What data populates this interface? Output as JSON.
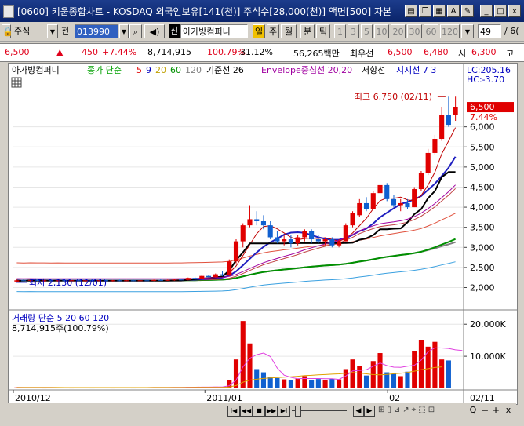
{
  "window": {
    "title": "[0600] 키움종합차트 - KOSDAQ 외국인보유[141(천)] 주식수[28,000(천)] 액면[500] 자본",
    "buttons": [
      "_",
      "□",
      "x"
    ]
  },
  "toolbar": {
    "market_label": "주식",
    "jeon_label": "전",
    "code": "013990",
    "company_chip": "신",
    "company_name": "아가방컴퍼니",
    "period_tabs": [
      "일",
      "주",
      "월",
      "분",
      "틱"
    ],
    "minute_numbers": [
      "1",
      "3",
      "5",
      "10",
      "20",
      "30",
      "60",
      "120"
    ],
    "count_value": "49",
    "right_edge": "/ 6("
  },
  "info": {
    "price": "6,500",
    "arrow": "▲",
    "change": "450",
    "change_pct": "+7.44%",
    "volume": "8,714,915",
    "vol_ratio": "100.79%",
    "turnover": "31.12%",
    "amount": "56,265백만",
    "best_label": "최우선",
    "ask": "6,500",
    "bid": "6,480",
    "open_label": "시",
    "open": "6,300",
    "high_label": "고"
  },
  "chart_data": {
    "type": "candlestick",
    "legend": {
      "name": "아가방컴퍼니",
      "ma_label": "종가 단순",
      "ma_periods": [
        "5",
        "9",
        "20",
        "60",
        "120"
      ],
      "kijun": "기준선 26",
      "envelope": "Envelope중심선 20,20",
      "resistance": "저항선",
      "support": "지지선 7 3"
    },
    "top_right": {
      "lc": "LC:205.16",
      "hc": "HC:-3.70"
    },
    "current_price_label": "6,500",
    "current_pct_label": "7.44%",
    "max_annotation": "최고 6,750 (02/11)",
    "min_annotation": "최저 2,130 (12/01)",
    "y_price_ticks": [
      6000,
      5500,
      5000,
      4500,
      4000,
      3500,
      3000,
      2500,
      2000
    ],
    "y_price_labels": [
      "6,000",
      "5,500",
      "5,000",
      "4,500",
      "4,000",
      "3,500",
      "3,000",
      "2,500",
      "2,000"
    ],
    "ylim": [
      1600,
      6950
    ],
    "candles": [
      {
        "o": 2150,
        "h": 2200,
        "l": 2130,
        "c": 2180
      },
      {
        "o": 2180,
        "h": 2210,
        "l": 2160,
        "c": 2170
      },
      {
        "o": 2170,
        "h": 2200,
        "l": 2150,
        "c": 2190
      },
      {
        "o": 2190,
        "h": 2200,
        "l": 2160,
        "c": 2170
      },
      {
        "o": 2170,
        "h": 2190,
        "l": 2150,
        "c": 2180
      },
      {
        "o": 2180,
        "h": 2200,
        "l": 2160,
        "c": 2170
      },
      {
        "o": 2170,
        "h": 2190,
        "l": 2150,
        "c": 2180
      },
      {
        "o": 2180,
        "h": 2200,
        "l": 2160,
        "c": 2170
      },
      {
        "o": 2170,
        "h": 2190,
        "l": 2160,
        "c": 2180
      },
      {
        "o": 2180,
        "h": 2200,
        "l": 2160,
        "c": 2170
      },
      {
        "o": 2170,
        "h": 2190,
        "l": 2150,
        "c": 2180
      },
      {
        "o": 2180,
        "h": 2200,
        "l": 2160,
        "c": 2170
      },
      {
        "o": 2170,
        "h": 2190,
        "l": 2160,
        "c": 2180
      },
      {
        "o": 2180,
        "h": 2200,
        "l": 2160,
        "c": 2170
      },
      {
        "o": 2170,
        "h": 2190,
        "l": 2150,
        "c": 2180
      },
      {
        "o": 2180,
        "h": 2200,
        "l": 2160,
        "c": 2170
      },
      {
        "o": 2170,
        "h": 2190,
        "l": 2160,
        "c": 2180
      },
      {
        "o": 2180,
        "h": 2200,
        "l": 2160,
        "c": 2170
      },
      {
        "o": 2170,
        "h": 2190,
        "l": 2160,
        "c": 2180
      },
      {
        "o": 2180,
        "h": 2200,
        "l": 2160,
        "c": 2170
      },
      {
        "o": 2170,
        "h": 2200,
        "l": 2160,
        "c": 2190
      },
      {
        "o": 2190,
        "h": 2210,
        "l": 2170,
        "c": 2180
      },
      {
        "o": 2180,
        "h": 2200,
        "l": 2170,
        "c": 2190
      },
      {
        "o": 2190,
        "h": 2220,
        "l": 2170,
        "c": 2200
      },
      {
        "o": 2200,
        "h": 2220,
        "l": 2180,
        "c": 2190
      },
      {
        "o": 2190,
        "h": 2250,
        "l": 2180,
        "c": 2240
      },
      {
        "o": 2240,
        "h": 2270,
        "l": 2200,
        "c": 2220
      },
      {
        "o": 2220,
        "h": 2300,
        "l": 2210,
        "c": 2290
      },
      {
        "o": 2290,
        "h": 2320,
        "l": 2250,
        "c": 2260
      },
      {
        "o": 2260,
        "h": 2350,
        "l": 2250,
        "c": 2330
      },
      {
        "o": 2330,
        "h": 2400,
        "l": 2280,
        "c": 2300
      },
      {
        "o": 2300,
        "h": 2700,
        "l": 2290,
        "c": 2650
      },
      {
        "o": 2650,
        "h": 3200,
        "l": 2600,
        "c": 3150
      },
      {
        "o": 3150,
        "h": 3600,
        "l": 3000,
        "c": 3550
      },
      {
        "o": 3550,
        "h": 4050,
        "l": 3500,
        "c": 3700
      },
      {
        "o": 3700,
        "h": 3900,
        "l": 3550,
        "c": 3650
      },
      {
        "o": 3650,
        "h": 3800,
        "l": 3450,
        "c": 3550
      },
      {
        "o": 3550,
        "h": 3650,
        "l": 3200,
        "c": 3250
      },
      {
        "o": 3250,
        "h": 3400,
        "l": 3100,
        "c": 3150
      },
      {
        "o": 3150,
        "h": 3300,
        "l": 3050,
        "c": 3200
      },
      {
        "o": 3200,
        "h": 3300,
        "l": 3000,
        "c": 3100
      },
      {
        "o": 3100,
        "h": 3300,
        "l": 3050,
        "c": 3250
      },
      {
        "o": 3250,
        "h": 3450,
        "l": 3150,
        "c": 3400
      },
      {
        "o": 3400,
        "h": 3450,
        "l": 3100,
        "c": 3200
      },
      {
        "o": 3200,
        "h": 3300,
        "l": 3100,
        "c": 3150
      },
      {
        "o": 3150,
        "h": 3250,
        "l": 3050,
        "c": 3200
      },
      {
        "o": 3200,
        "h": 3250,
        "l": 3000,
        "c": 3050
      },
      {
        "o": 3050,
        "h": 3200,
        "l": 3000,
        "c": 3150
      },
      {
        "o": 3150,
        "h": 3600,
        "l": 3150,
        "c": 3550
      },
      {
        "o": 3550,
        "h": 3900,
        "l": 3500,
        "c": 3850
      },
      {
        "o": 3800,
        "h": 4200,
        "l": 3750,
        "c": 4100
      },
      {
        "o": 4100,
        "h": 4250,
        "l": 3900,
        "c": 3950
      },
      {
        "o": 3950,
        "h": 4400,
        "l": 3950,
        "c": 4350
      },
      {
        "o": 4350,
        "h": 4650,
        "l": 4300,
        "c": 4550
      },
      {
        "o": 4550,
        "h": 4600,
        "l": 4150,
        "c": 4200
      },
      {
        "o": 4200,
        "h": 4300,
        "l": 4000,
        "c": 4050
      },
      {
        "o": 4050,
        "h": 4200,
        "l": 3900,
        "c": 4100
      },
      {
        "o": 4100,
        "h": 4200,
        "l": 3950,
        "c": 4000
      },
      {
        "o": 4000,
        "h": 4500,
        "l": 4000,
        "c": 4450
      },
      {
        "o": 4450,
        "h": 4900,
        "l": 4400,
        "c": 4850
      },
      {
        "o": 4850,
        "h": 5450,
        "l": 4800,
        "c": 5350
      },
      {
        "o": 5350,
        "h": 5800,
        "l": 5300,
        "c": 5700
      },
      {
        "o": 5700,
        "h": 6500,
        "l": 5650,
        "c": 6300
      },
      {
        "o": 6300,
        "h": 6750,
        "l": 6000,
        "c": 6050
      },
      {
        "o": 6300,
        "h": 6750,
        "l": 6150,
        "c": 6500
      }
    ],
    "volume": {
      "label": "거래량 단순 5 20 60 120",
      "current": "8,714,915주(100.79%)",
      "y_ticks": [
        20000,
        10000
      ],
      "y_labels": [
        "20,000K",
        "10,000K"
      ],
      "ylim": [
        0,
        22500
      ],
      "values": [
        300,
        250,
        280,
        260,
        240,
        270,
        250,
        260,
        240,
        250,
        260,
        240,
        250,
        260,
        240,
        250,
        260,
        240,
        250,
        260,
        300,
        280,
        320,
        350,
        330,
        400,
        380,
        450,
        420,
        500,
        480,
        2500,
        9000,
        21000,
        14000,
        6000,
        5000,
        3500,
        3200,
        2800,
        2600,
        3000,
        3800,
        2700,
        2900,
        2500,
        3000,
        2800,
        6000,
        9000,
        7000,
        4000,
        8500,
        11000,
        5000,
        4500,
        3800,
        5200,
        11500,
        15000,
        13000,
        14500,
        9000,
        8700
      ],
      "ma5": [
        300,
        280,
        275,
        270,
        260,
        260,
        255,
        255,
        255,
        252,
        252,
        250,
        250,
        250,
        250,
        250,
        250,
        250,
        250,
        250,
        260,
        265,
        280,
        300,
        316,
        336,
        356,
        386,
        396,
        430,
        446,
        830,
        2570,
        6670,
        9396,
        10500,
        11000,
        9900,
        6340,
        4100,
        3420,
        3020,
        3060,
        3060,
        3060,
        2980,
        2980,
        2780,
        3840,
        5460,
        5560,
        5800,
        6900,
        7900,
        7100,
        6600,
        6560,
        6900,
        7200,
        8800,
        11400,
        12640,
        12600,
        12440,
        12000,
        11800
      ],
      "ma20": [
        270,
        265,
        262,
        260,
        258,
        258,
        257,
        256,
        256,
        256,
        256,
        256,
        255,
        255,
        255,
        255,
        255,
        255,
        255,
        255,
        258,
        260,
        263,
        266,
        270,
        275,
        282,
        292,
        300,
        312,
        322,
        440,
        870,
        1900,
        2560,
        2840,
        3070,
        3230,
        3370,
        3500,
        3630,
        3770,
        3950,
        4070,
        4200,
        4300,
        4420,
        4520,
        4700,
        4950,
        4770,
        4520,
        4280,
        4210,
        4350,
        4550,
        4700,
        4950,
        5350,
        5800,
        6150,
        6500,
        6700
      ]
    },
    "x_labels": [
      "2010/12",
      "2011/01",
      "02",
      "02/11"
    ]
  },
  "bottom_controls": [
    "◀",
    "▶",
    "I◀",
    "◀◀",
    "■",
    "▶▶",
    "▶I",
    "Q",
    "−",
    "+",
    "x"
  ]
}
